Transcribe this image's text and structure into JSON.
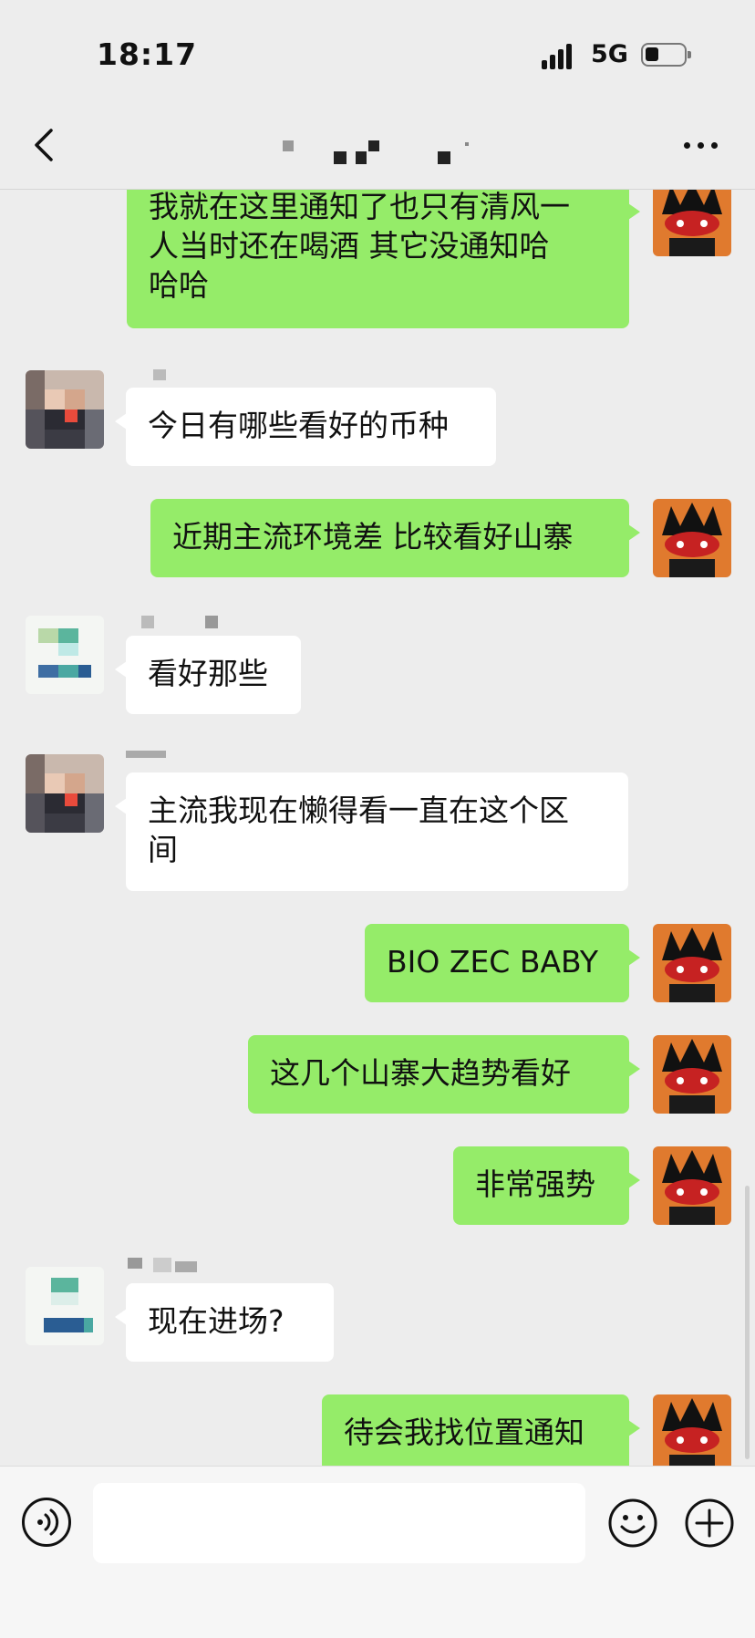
{
  "status_bar": {
    "time": "18:17",
    "network": "5G",
    "battery_level": 0.2
  },
  "nav": {
    "back_icon": "chevron-left-icon",
    "more_icon": "more-dots-icon"
  },
  "colors": {
    "outgoing_bubble": "#95ec69",
    "incoming_bubble": "#ffffff",
    "background": "#ededed"
  },
  "messages": [
    {
      "side": "out",
      "text": "我就在这里通知了也只有清风一\n人当时还在喝酒 其它没通知哈\n哈哈"
    },
    {
      "side": "in",
      "text": "今日有哪些看好的币种"
    },
    {
      "side": "out",
      "text": "近期主流环境差 比较看好山寨"
    },
    {
      "side": "in",
      "text": "看好那些"
    },
    {
      "side": "in",
      "text": "主流我现在懒得看一直在这个区\n间"
    },
    {
      "side": "out",
      "text": "BIO ZEC BABY"
    },
    {
      "side": "out",
      "text": "这几个山寨大趋势看好"
    },
    {
      "side": "out",
      "text": "非常强势"
    },
    {
      "side": "in",
      "text": "现在进场?"
    },
    {
      "side": "out",
      "text": "待会我找位置通知"
    }
  ],
  "input_bar": {
    "voice_icon": "voice-icon",
    "emoji_icon": "emoji-icon",
    "plus_icon": "plus-icon",
    "input_value": ""
  }
}
